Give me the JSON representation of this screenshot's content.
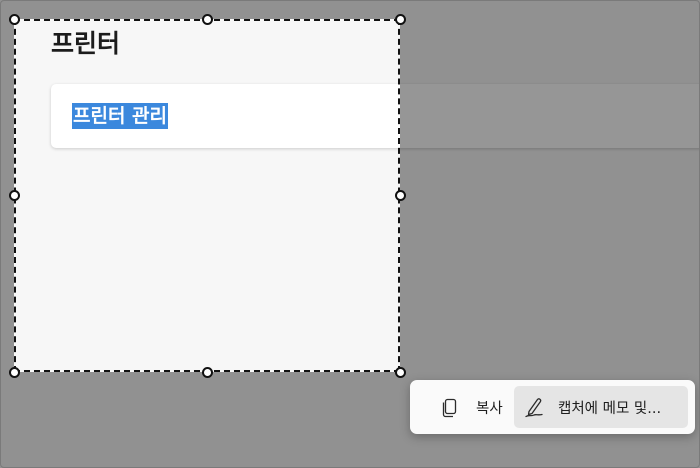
{
  "page": {
    "title": "프린터",
    "card_label": "프린터 관리"
  },
  "snip_toolbar": {
    "copy": {
      "label": "복사",
      "icon": "copy-icon"
    },
    "annotate": {
      "label": "캡처에 메모 및...",
      "icon": "pen-annotate-icon"
    }
  },
  "colors": {
    "selection_highlight": "#3b88dd",
    "dim_overlay": "rgba(0,0,0,0.41)",
    "page_background": "#f7f7f7"
  }
}
